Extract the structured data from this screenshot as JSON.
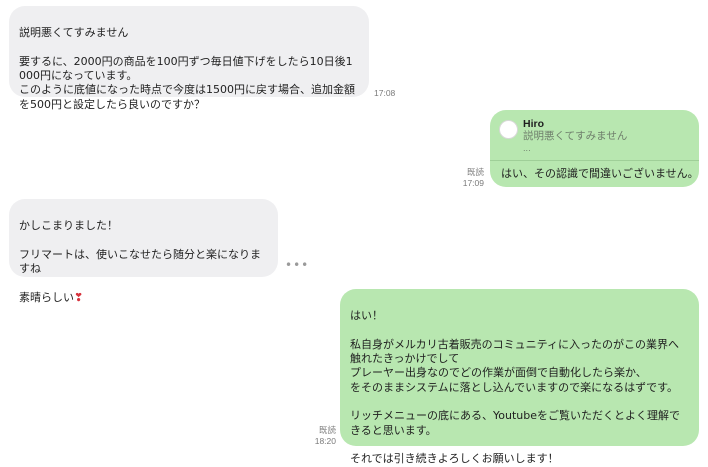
{
  "messages": [
    {
      "text": "説明悪くてすみません\n\n要するに、2000円の商品を100円ずつ毎日値下げをしたら10日後1000円になっています。\nこのように底値になった時点で今度は1500円に戻す場合、追加金額を500円と設定したら良いのですか？",
      "time": "17:08"
    },
    {
      "reply_to": {
        "name": "Hiro",
        "text": "説明悪くてすみません",
        "ellipsis": "..."
      },
      "text": "はい、その認識で間違いございません。",
      "read": "既読",
      "time": "17:09"
    },
    {
      "text": "かしこまりました！\n\nフリマートは、使いこなせたら随分と楽になりますね\n\n素晴らしい",
      "emoji": "❣",
      "more": "•••"
    },
    {
      "text": "はい！\n\n私自身がメルカリ古着販売のコミュニティに入ったのがこの業界へ触れたきっかけでして\nプレーヤー出身なのでどの作業が面倒で自動化したら楽か、\nをそのままシステムに落とし込んでいますので楽になるはずです。\n\nリッチメニューの底にある、Youtubeをご覧いただくとよく理解できると思います。\n\nそれでは引き続きよろしくお願いします！",
      "read": "既読",
      "time": "18:20"
    }
  ],
  "colors": {
    "incoming": "#efeff1",
    "outgoing": "#b8e7b0"
  },
  "icons": {
    "avatar": "pink-character-avatar-icon",
    "more": "more-options-icon"
  }
}
